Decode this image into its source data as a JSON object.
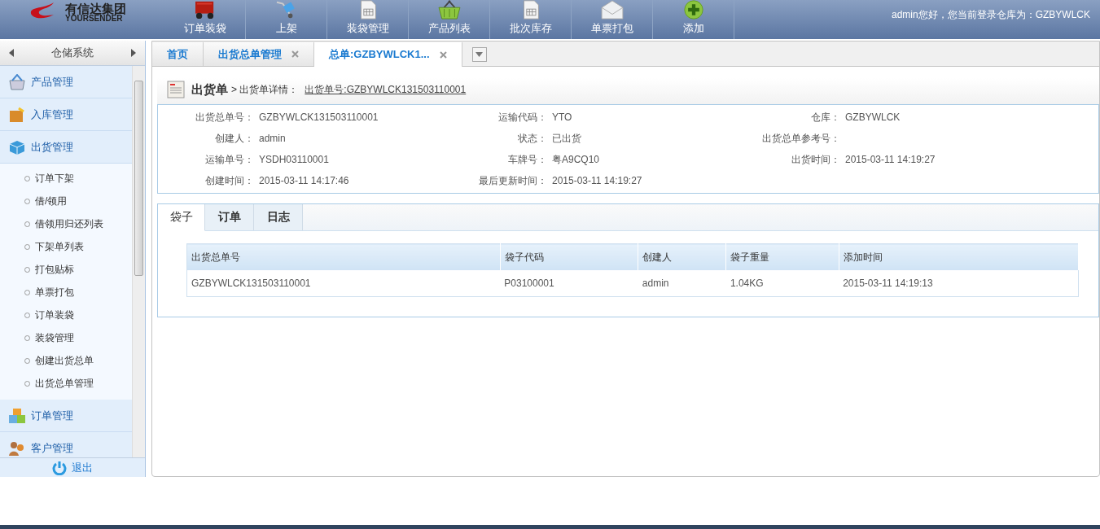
{
  "header": {
    "logo_cn": "有信达集团",
    "logo_en": "YOURSENDER",
    "nav": [
      {
        "kind": "truck",
        "label": "订单装袋"
      },
      {
        "kind": "cart",
        "label": "上架"
      },
      {
        "kind": "sheet",
        "label": "装袋管理"
      },
      {
        "kind": "basket",
        "label": "产品列表"
      },
      {
        "kind": "sheet",
        "label": "批次库存"
      },
      {
        "kind": "envelope",
        "label": "单票打包"
      },
      {
        "kind": "plus",
        "label": "添加"
      }
    ],
    "user_text": "admin您好，您当前登录仓库为：GZBYWLCK"
  },
  "sidebar": {
    "title": "仓储系统",
    "groups": [
      {
        "kind": "product",
        "label": "产品管理"
      },
      {
        "kind": "inbound",
        "label": "入库管理"
      },
      {
        "kind": "outbound",
        "label": "出货管理",
        "children": [
          "订单下架",
          "借/领用",
          "借领用归还列表",
          "下架单列表",
          "打包贴标",
          "单票打包",
          "订单装袋",
          "装袋管理",
          "创建出货总单",
          "出货总单管理"
        ]
      },
      {
        "kind": "order",
        "label": "订单管理"
      },
      {
        "kind": "customer",
        "label": "客户管理"
      }
    ],
    "logout": "退出"
  },
  "tabs": [
    {
      "label": "首页",
      "closable": false,
      "selected": false
    },
    {
      "label": "出货总单管理",
      "closable": true,
      "selected": false
    },
    {
      "label": "总单:GZBYWLCK1...",
      "closable": true,
      "selected": true
    }
  ],
  "breadcrumb": {
    "title": "出货单",
    "detail": "> 出货单详情：",
    "link": "出货单号:GZBYWLCK131503110001"
  },
  "fields": [
    {
      "label": "出货总单号：",
      "value": "GZBYWLCK131503110001"
    },
    {
      "label": "运输代码：",
      "value": "YTO"
    },
    {
      "label": "仓库：",
      "value": "GZBYWLCK"
    },
    {
      "label": "创建人：",
      "value": "admin"
    },
    {
      "label": "状态：",
      "value": "已出货"
    },
    {
      "label": "出货总单参考号："
    },
    {
      "label": "运输单号：",
      "value": "YSDH03110001"
    },
    {
      "label": "车牌号：",
      "value": "粤A9CQ10"
    },
    {
      "label": "出货时间：",
      "value": "2015-03-11 14:19:27"
    },
    {
      "label": "创建时间：",
      "value": "2015-03-11 14:17:46"
    },
    {
      "label": "最后更新时间：",
      "value": "2015-03-11 14:19:27"
    }
  ],
  "sub_tabs": [
    {
      "label": "袋子",
      "selected": true
    },
    {
      "label": "订单",
      "selected": false
    },
    {
      "label": "日志",
      "selected": false
    }
  ],
  "table": {
    "columns": [
      "出货总单号",
      "袋子代码",
      "创建人",
      "袋子重量",
      "添加时间"
    ],
    "rows": [
      [
        "GZBYWLCK131503110001",
        "P03100001",
        "admin",
        "1.04KG",
        "2015-03-11 14:19:13"
      ]
    ]
  }
}
